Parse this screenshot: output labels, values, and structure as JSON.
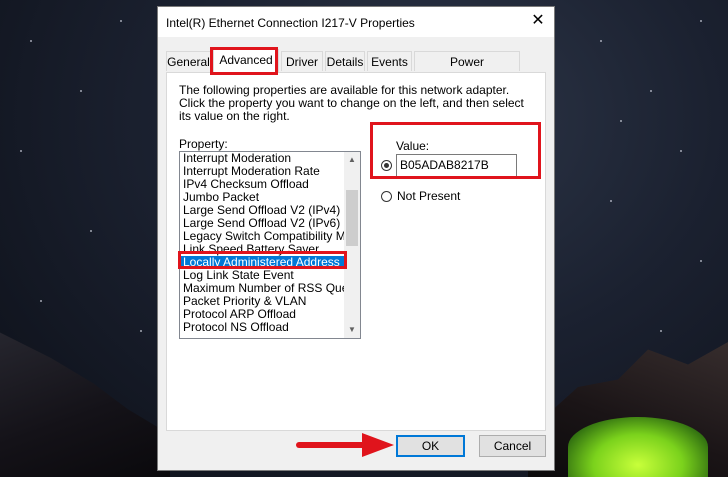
{
  "dialog": {
    "title": "Intel(R) Ethernet Connection I217-V Properties",
    "close_glyph": "✕"
  },
  "tabs": [
    {
      "label": "General"
    },
    {
      "label": "Advanced"
    },
    {
      "label": "Driver"
    },
    {
      "label": "Details"
    },
    {
      "label": "Events"
    },
    {
      "label": "Power Management"
    }
  ],
  "active_tab": "Advanced",
  "advanced": {
    "description": "The following properties are available for this network adapter. Click the property you want to change on the left, and then select its value on the right.",
    "property_label": "Property:",
    "properties": [
      "Interrupt Moderation",
      "Interrupt Moderation Rate",
      "IPv4 Checksum Offload",
      "Jumbo Packet",
      "Large Send Offload V2 (IPv4)",
      "Large Send Offload V2 (IPv6)",
      "Legacy Switch Compatibility Mode",
      "Link Speed Battery Saver",
      "Locally Administered Address",
      "Log Link State Event",
      "Maximum Number of RSS Queues",
      "Packet Priority & VLAN",
      "Protocol ARP Offload",
      "Protocol NS Offload"
    ],
    "selected_property": "Locally Administered Address",
    "value_label": "Value:",
    "value": "B05ADAB8217B",
    "not_present_label": "Not Present"
  },
  "buttons": {
    "ok": "OK",
    "cancel": "Cancel"
  },
  "colors": {
    "highlight": "#e0141c",
    "selection": "#0078d7"
  }
}
